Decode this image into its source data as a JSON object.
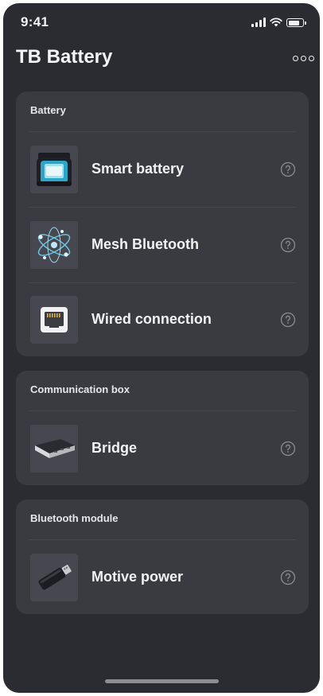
{
  "status_bar": {
    "time": "9:41"
  },
  "header": {
    "title": "TB Battery"
  },
  "sections": [
    {
      "title": "Battery",
      "items": [
        {
          "label": "Smart battery",
          "icon": "smart-battery-icon"
        },
        {
          "label": "Mesh Bluetooth",
          "icon": "mesh-bluetooth-icon"
        },
        {
          "label": "Wired connection",
          "icon": "ethernet-port-icon"
        }
      ]
    },
    {
      "title": "Communication box",
      "items": [
        {
          "label": "Bridge",
          "icon": "bridge-device-icon"
        }
      ]
    },
    {
      "title": "Bluetooth module",
      "items": [
        {
          "label": "Motive power",
          "icon": "bluetooth-dongle-icon"
        }
      ]
    }
  ],
  "colors": {
    "background": "#2b2c32",
    "card": "#3a3b41",
    "thumb": "#46474e",
    "text": "#f2f2f4",
    "help_icon": "#8a8b92"
  }
}
